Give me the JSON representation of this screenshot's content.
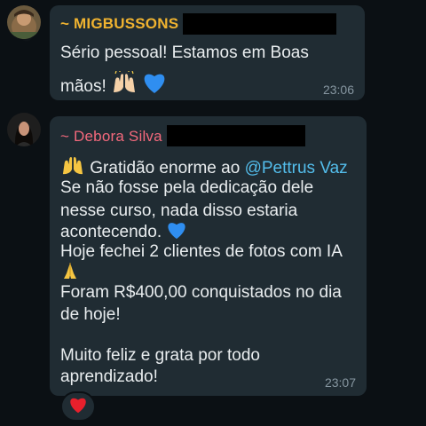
{
  "messages": [
    {
      "sender": "~ MIGBUSSONS",
      "sender_color": "#f0b330",
      "lines": [
        "Sério pessoal! Estamos em Boas",
        "mãos!"
      ],
      "emojis": [
        "raising-hands",
        "blue-heart"
      ],
      "time": "23:06"
    },
    {
      "sender": "~ Debora Silva",
      "sender_color": "#f3697c",
      "intro": "Gratidão enorme ao",
      "mention": "@Pettrus Vaz",
      "lines": [
        "Se não fosse pela dedicação dele",
        "nesse curso, nada disso estaria",
        "acontecendo.",
        "Hoje fechei 2 clientes de fotos com IA",
        "Foram R$400,00 conquistados no dia",
        "de hoje!",
        "Muito feliz e grata por todo",
        "aprendizado!"
      ],
      "emojis": [
        "raising-hands",
        "blue-heart",
        "folded-hands"
      ],
      "time": "23:07",
      "reaction": "red-heart"
    }
  ],
  "colors": {
    "background": "#0b1014",
    "bubble": "#202c33",
    "text": "#e9edef",
    "timestamp": "#8696a0",
    "mention": "#53bdeb"
  }
}
